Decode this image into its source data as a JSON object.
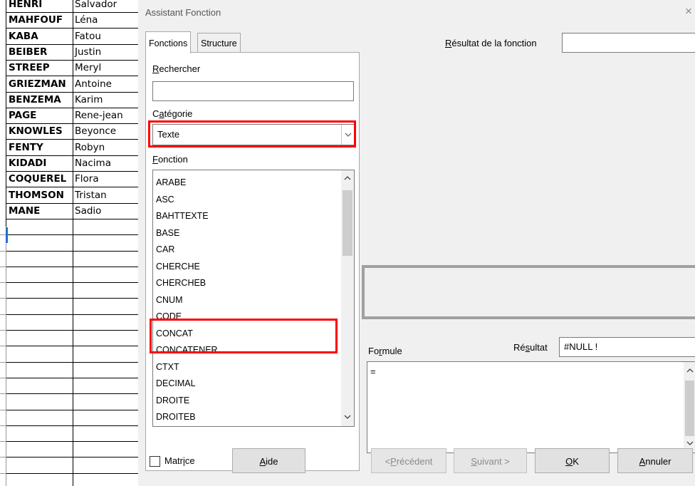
{
  "sheet": {
    "rows": [
      {
        "last": "HENRI",
        "first": "Salvador"
      },
      {
        "last": "MAHFOUF",
        "first": "Léna"
      },
      {
        "last": "KABA",
        "first": "Fatou"
      },
      {
        "last": "BEIBER",
        "first": "Justin"
      },
      {
        "last": "STREEP",
        "first": "Meryl"
      },
      {
        "last": "GRIEZMAN",
        "first": "Antoine"
      },
      {
        "last": "BENZEMA",
        "first": "Karim"
      },
      {
        "last": "PAGE",
        "first": "Rene-jean"
      },
      {
        "last": "KNOWLES",
        "first": "Beyonce"
      },
      {
        "last": "FENTY",
        "first": "Robyn"
      },
      {
        "last": "KIDADI",
        "first": "Nacima"
      },
      {
        "last": "COQUEREL",
        "first": "Flora"
      },
      {
        "last": "THOMSON",
        "first": "Tristan"
      },
      {
        "last": "MANE",
        "first": "Sadio"
      }
    ]
  },
  "dialog": {
    "title": "Assistant Fonction",
    "close": "×",
    "tabs": {
      "functions": "Fonctions",
      "structure": "Structure"
    },
    "search_label": "Rechercher",
    "search_value": "",
    "category_label": "Catégorie",
    "category_value": "Texte",
    "function_label": "Fonction",
    "functions": [
      "ARABE",
      "ASC",
      "BAHTTEXTE",
      "BASE",
      "CAR",
      "CHERCHE",
      "CHERCHEB",
      "CNUM",
      "CODE",
      "CONCAT",
      "CONCATENER",
      "CTXT",
      "DECIMAL",
      "DROITE",
      "DROITEB"
    ],
    "result_fn_label": "Résultat de la fonction",
    "result_fn_value": "",
    "formula_label": "Formule",
    "result_label": "Résultat",
    "result_value": "#NULL !",
    "formula_value": "=",
    "matrix_label": "Matrice",
    "buttons": {
      "help": "Aide",
      "previous": "<Précédent",
      "next": "Suivant >",
      "ok": "OK",
      "cancel": "Annuler"
    },
    "highlight_color": "#ff0000"
  }
}
